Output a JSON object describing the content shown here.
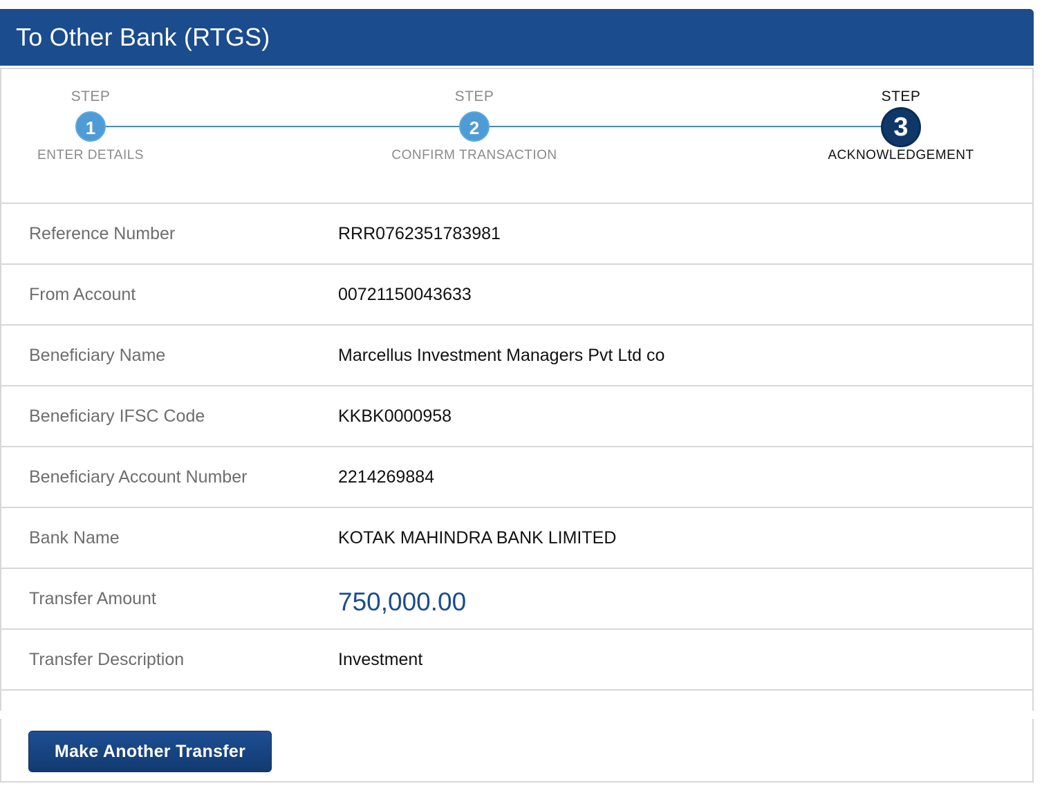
{
  "header": {
    "title": "To Other Bank (RTGS)"
  },
  "stepper": {
    "steps": [
      {
        "caption": "STEP",
        "number": "1",
        "label": "ENTER DETAILS",
        "active": false
      },
      {
        "caption": "STEP",
        "number": "2",
        "label": "CONFIRM TRANSACTION",
        "active": false
      },
      {
        "caption": "STEP",
        "number": "3",
        "label": "ACKNOWLEDGEMENT",
        "active": true
      }
    ]
  },
  "details": {
    "rows": [
      {
        "label": "Reference Number",
        "value": "RRR0762351783981"
      },
      {
        "label": "From Account",
        "value": "00721150043633"
      },
      {
        "label": "Beneficiary Name",
        "value": "Marcellus Investment Managers Pvt Ltd co"
      },
      {
        "label": "Beneficiary IFSC Code",
        "value": "KKBK0000958"
      },
      {
        "label": "Beneficiary Account Number",
        "value": "2214269884"
      },
      {
        "label": "Bank Name",
        "value": "KOTAK MAHINDRA BANK LIMITED"
      },
      {
        "label": "Transfer Amount",
        "value": "750,000.00"
      },
      {
        "label": "Transfer Description",
        "value": "Investment"
      }
    ]
  },
  "actions": {
    "make_another_label": "Make Another Transfer"
  },
  "colors": {
    "header_bg": "#1a4c8e",
    "step_inactive": "#4f9bd6",
    "step_active": "#0f3868",
    "amount": "#1a4c8e"
  }
}
